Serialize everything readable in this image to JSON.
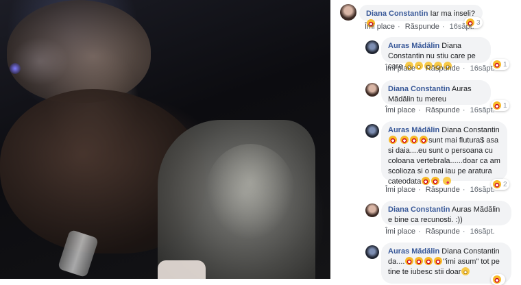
{
  "comments": [
    {
      "author": "Diana Constantin",
      "text": "Iar ma inseli?",
      "like": "Îmi place",
      "reply": "Răspunde",
      "time": "16săpt.",
      "reactions": "3"
    },
    {
      "author": "Auras Mădălin",
      "text": "Diana Constantin nu stiu care pe care",
      "like": "Îmi place",
      "reply": "Răspunde",
      "time": "16săpt.",
      "reactions": "1"
    },
    {
      "author": "Diana Constantin",
      "text": "Auras Mădălin tu mereu",
      "like": "Îmi place",
      "reply": "Răspunde",
      "time": "16săpt.",
      "reactions": "1"
    },
    {
      "author": "Auras Mădălin",
      "text_a": "Diana Constantin",
      "text_b": "sunt mai flutura$ asa si daia....eu sunt o persoana cu coloana vertebrala......doar ca am scolioza si o mai iau pe aratura cateodata",
      "like": "Îmi place",
      "reply": "Răspunde",
      "time": "16săpt.",
      "reactions": "2"
    },
    {
      "author": "Diana Constantin",
      "text": "Auras Mădălin e bine ca recunosti. :))",
      "like": "Îmi place",
      "reply": "Răspunde",
      "time": "16săpt."
    },
    {
      "author": "Auras Mădălin",
      "text_a": "Diana Constantin da....",
      "text_b": "\"imi asum\" tot pe tine te iubesc stii doar"
    }
  ],
  "icons": {
    "reaction": "laughing-face-icon",
    "emoji": "grinning-face-icon",
    "kiss": "kissing-face-icon"
  },
  "colors": {
    "name": "#385898",
    "bubble": "#f2f3f5",
    "meta": "#606770"
  }
}
